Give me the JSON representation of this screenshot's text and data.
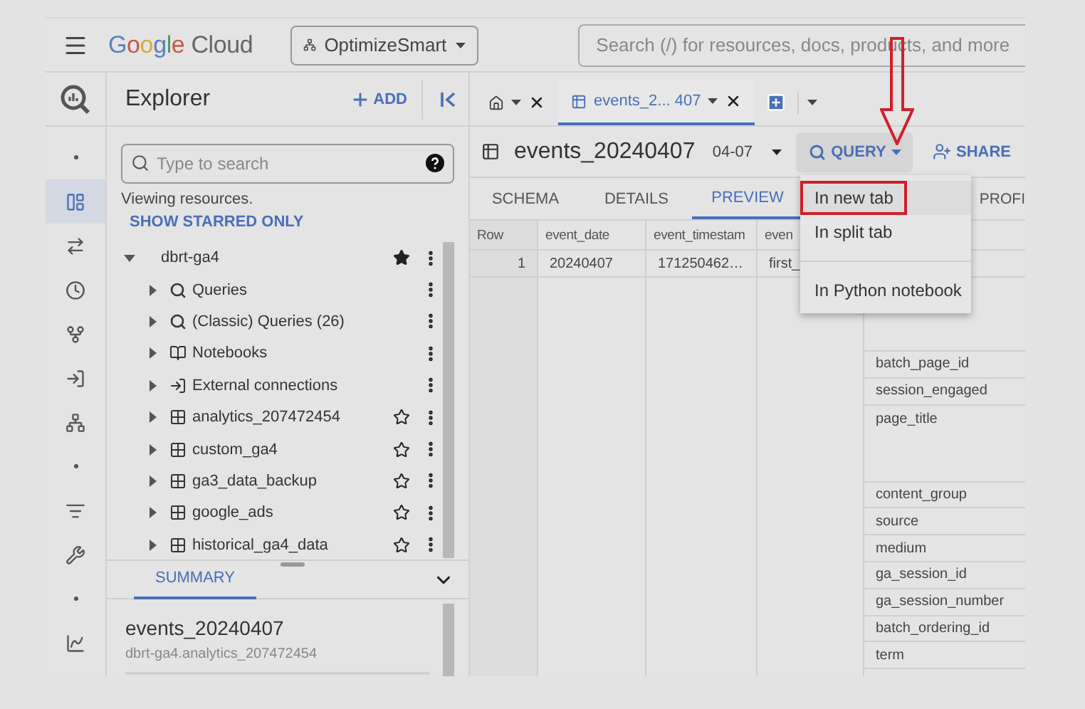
{
  "topbar": {
    "logo": "Google Cloud",
    "project": "OptimizeSmart",
    "search": {
      "placeholder": "Search (/) for resources, docs, products, and more"
    }
  },
  "rail": {
    "items": [
      {
        "kind": "dot",
        "selected": false
      },
      {
        "kind": "tables",
        "selected": true
      },
      {
        "kind": "swap",
        "selected": false
      },
      {
        "kind": "clock",
        "selected": false
      },
      {
        "kind": "connect",
        "selected": false
      },
      {
        "kind": "pipeline",
        "selected": false
      },
      {
        "kind": "hierarchy",
        "selected": false
      },
      {
        "kind": "dot",
        "selected": false
      },
      {
        "kind": "list",
        "selected": false
      },
      {
        "kind": "wrench",
        "selected": false
      },
      {
        "kind": "dot",
        "selected": false
      },
      {
        "kind": "chart",
        "selected": false
      }
    ]
  },
  "explorer": {
    "title": "Explorer",
    "add": "ADD",
    "search": {
      "placeholder": "Type to search"
    },
    "status": "Viewing resources.",
    "starred_link": "SHOW STARRED ONLY",
    "tree": [
      {
        "label": "dbrt-ga4",
        "expanded": true,
        "starred": true,
        "children": [
          {
            "label": "Queries",
            "kind": "query",
            "expanded": false
          },
          {
            "label": "(Classic) Queries (26)",
            "kind": "query",
            "expanded": false
          },
          {
            "label": "Notebooks",
            "kind": "notebook",
            "expanded": false
          },
          {
            "label": "External connections",
            "kind": "connection",
            "expanded": false
          },
          {
            "label": "analytics_207472454",
            "kind": "dataset",
            "expanded": false,
            "starred": false
          },
          {
            "label": "custom_ga4",
            "kind": "dataset",
            "expanded": false,
            "starred": false
          },
          {
            "label": "ga3_data_backup",
            "kind": "dataset",
            "expanded": false,
            "starred": false
          },
          {
            "label": "google_ads",
            "kind": "dataset",
            "expanded": false,
            "starred": false
          },
          {
            "label": "historical_ga4_data",
            "kind": "dataset",
            "expanded": false,
            "starred": false
          }
        ]
      }
    ],
    "summary": {
      "tab": "SUMMARY",
      "title": "events_20240407",
      "path": "dbrt-ga4.analytics_207472454"
    }
  },
  "main": {
    "tabs": [
      {
        "kind": "home",
        "selected": false
      },
      {
        "kind": "table",
        "label": "events_2... 407",
        "selected": true
      }
    ],
    "title": "events_20240407",
    "date": "04-07",
    "query": "QUERY",
    "share": "SHARE",
    "subtabs": [
      {
        "label": "SCHEMA",
        "selected": false
      },
      {
        "label": "DETAILS",
        "selected": false
      },
      {
        "label": "PREVIEW",
        "selected": true
      },
      {
        "label": "PROFI",
        "selected": false
      }
    ],
    "table": {
      "columns": [
        "Row",
        "event_date",
        "event_timestam",
        "even"
      ],
      "rows": [
        [
          "1",
          "20240407",
          "171250462…",
          "first_"
        ]
      ]
    },
    "nested_cells": [
      {
        "label": "batch_page_id",
        "kind": "single"
      },
      {
        "label": "session_engaged",
        "kind": "single"
      },
      {
        "label": "page_title",
        "kind": "tall"
      },
      {
        "label": "content_group",
        "kind": "single"
      },
      {
        "label": "source",
        "kind": "single"
      },
      {
        "label": "medium",
        "kind": "single"
      },
      {
        "label": "ga_session_id",
        "kind": "single"
      },
      {
        "label": "ga_session_number",
        "kind": "single"
      },
      {
        "label": "batch_ordering_id",
        "kind": "single"
      },
      {
        "label": "term",
        "kind": "single"
      }
    ],
    "menu": {
      "groups": [
        [
          {
            "label": "In new tab",
            "selected": true
          },
          {
            "label": "In split tab",
            "selected": false
          }
        ],
        [
          {
            "label": "In Python notebook",
            "selected": false
          }
        ]
      ]
    }
  }
}
